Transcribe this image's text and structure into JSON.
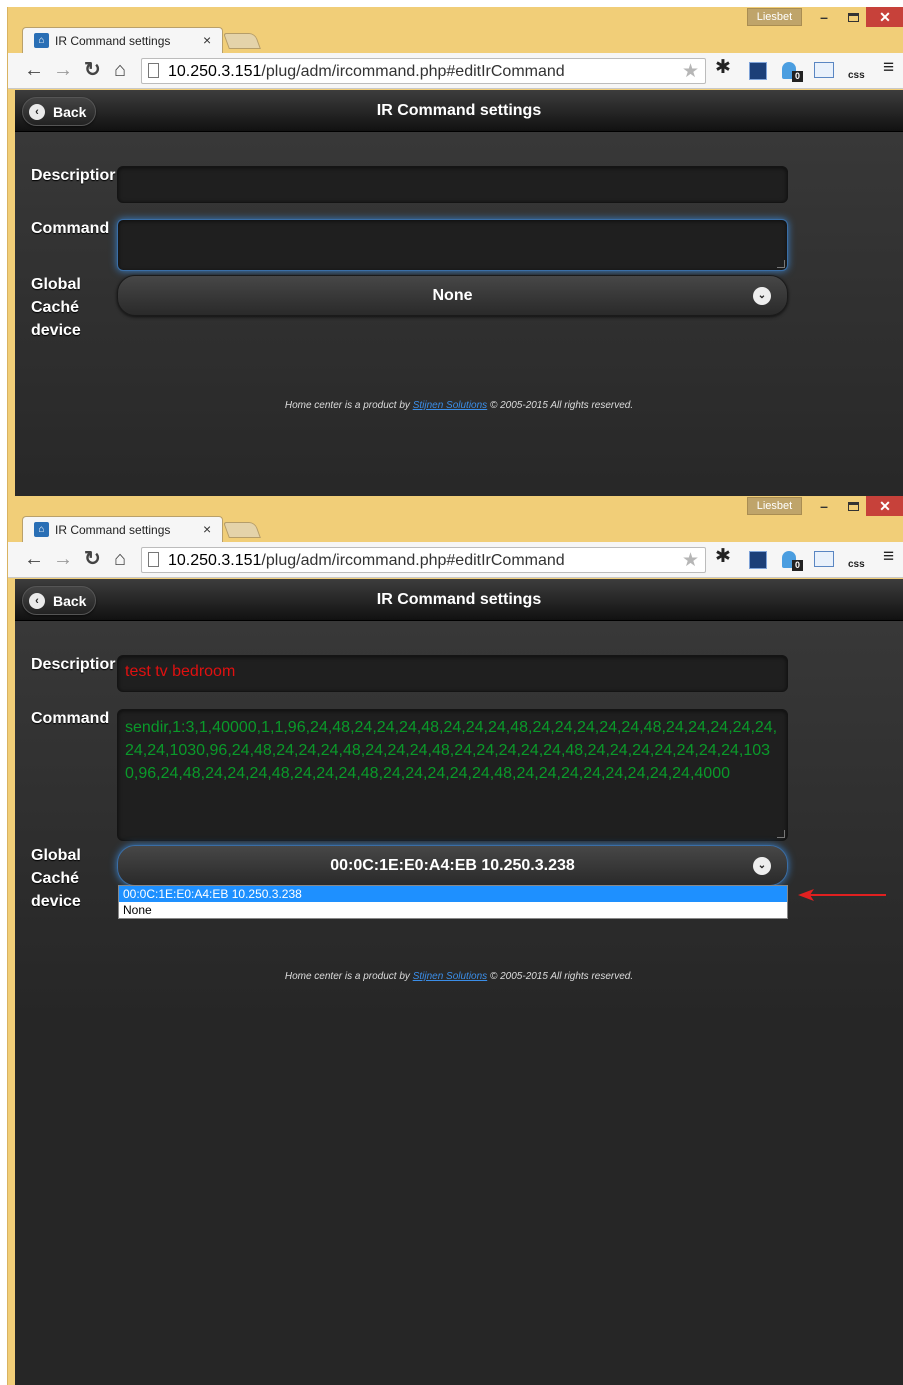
{
  "browser": {
    "profile_name": "Liesbet",
    "tab_title": "IR Command settings",
    "tab_close": "×",
    "url_host": "10.250.3.151",
    "url_path": "/plug/adm/ircommand.php#editIrCommand",
    "extension_badge_count": "0",
    "css_ext_label": "css"
  },
  "header": {
    "back_label": "Back",
    "title": "IR Command settings"
  },
  "form": {
    "description_label": "Descriptior",
    "command_label": "Command",
    "device_label_line1": "Global",
    "device_label_line2": "Caché",
    "device_label_line3": "device"
  },
  "screen1": {
    "description_value": "",
    "command_value": "",
    "device_selected": "None"
  },
  "screen2": {
    "description_value": "test tv bedroom",
    "command_value": "sendir,1:3,1,40000,1,1,96,24,48,24,24,24,48,24,24,24,48,24,24,24,24,24,48,24,24,24,24,24,24,24,1030,96,24,48,24,24,24,48,24,24,24,48,24,24,24,24,24,48,24,24,24,24,24,24,24,1030,96,24,48,24,24,24,48,24,24,24,48,24,24,24,24,24,48,24,24,24,24,24,24,24,24,4000",
    "device_selected": "00:0C:1E:E0:A4:EB 10.250.3.238",
    "device_options": [
      "00:0C:1E:E0:A4:EB 10.250.3.238",
      "None"
    ]
  },
  "footer": {
    "prefix": "Home center is a product by ",
    "link": "Stijnen Solutions",
    "suffix": " © 2005-2015 All rights reserved."
  },
  "colors": {
    "annotation_arrow": "#e02020",
    "description_text": "#e01010",
    "command_text": "#0a9a2a",
    "selected_option": "#1e90ff"
  }
}
